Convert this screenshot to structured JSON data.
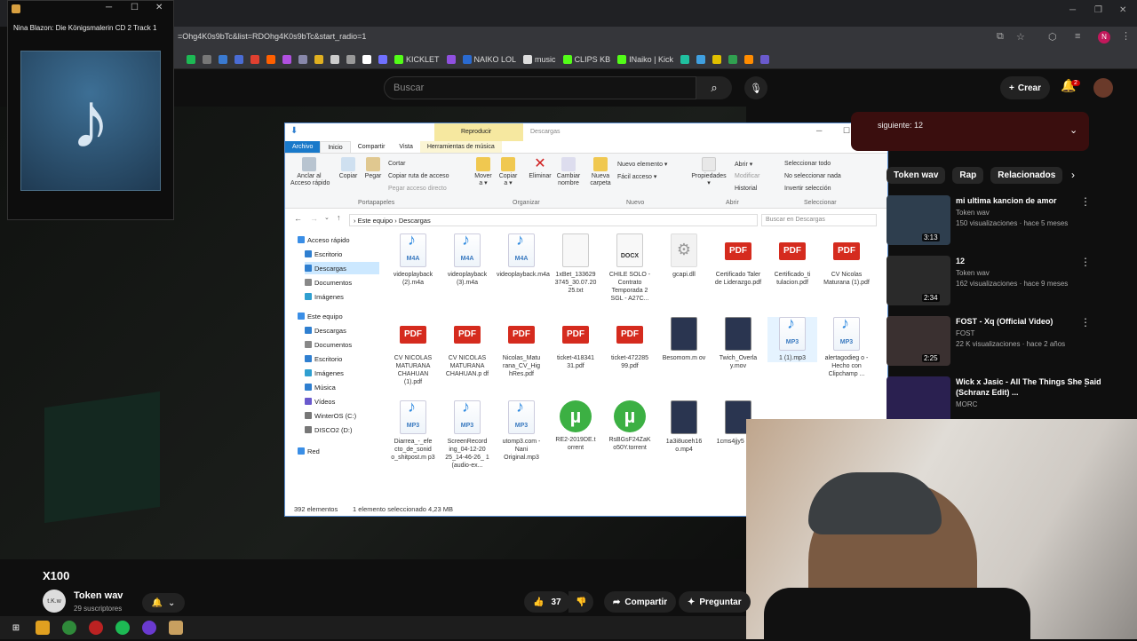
{
  "browser": {
    "url": "=Ohg4K0s9bTc&list=RDOhg4K0s9bTc&start_radio=1",
    "bookmarks": [
      {
        "label": "",
        "color": "#1db954"
      },
      {
        "label": "",
        "color": "#777"
      },
      {
        "label": "",
        "color": "#3a7ad0"
      },
      {
        "label": "",
        "color": "#4a6cd4"
      },
      {
        "label": "",
        "color": "#e04030"
      },
      {
        "label": "",
        "color": "#ff6000"
      },
      {
        "label": "",
        "color": "#b050e0"
      },
      {
        "label": "",
        "color": "#8888aa"
      },
      {
        "label": "",
        "color": "#e0b020"
      },
      {
        "label": "",
        "color": "#cccccc"
      },
      {
        "label": "",
        "color": "#999999"
      },
      {
        "label": "",
        "color": "#ffffff"
      },
      {
        "label": "",
        "color": "#7070ff"
      },
      {
        "label": "KICKLET",
        "color": "#53fc18"
      },
      {
        "label": "",
        "color": "#9050e0"
      },
      {
        "label": "NAIKO LOL",
        "color": "#2a6ad0"
      },
      {
        "label": "music",
        "color": "#dddddd"
      },
      {
        "label": "CLIPS KB",
        "color": "#53fc18"
      },
      {
        "label": "INaiko | Kick",
        "color": "#53fc18"
      },
      {
        "label": "",
        "color": "#20c0a0"
      },
      {
        "label": "",
        "color": "#40a0e0"
      },
      {
        "label": "",
        "color": "#e0c000"
      },
      {
        "label": "",
        "color": "#30a050"
      },
      {
        "label": "",
        "color": "#ff8c00"
      },
      {
        "label": "",
        "color": "#6a5acd"
      }
    ],
    "profile": "N"
  },
  "player": {
    "title": "Nina Blazon: Die Königsmalerin CD 2 Track 1",
    "art_icon": "music-note-icon"
  },
  "youtube": {
    "search_placeholder": "Buscar",
    "create_label": "Crear",
    "notifications": "2",
    "video_title": "X100",
    "channel_name": "Token wav",
    "channel_subs": "29 suscriptores",
    "channel_avatar_text": "t.K.w",
    "likes": "37",
    "share": "Compartir",
    "ask": "Preguntar",
    "queue_label": "siguiente: 12",
    "chips": [
      "Token wav",
      "Rap",
      "Relacionados"
    ],
    "related": [
      {
        "title": "mi ultima kancion de amor",
        "channel": "Token wav",
        "meta": "150 visualizaciones · hace 5 meses",
        "duration": "3:13",
        "thumb": "#2e3e4e"
      },
      {
        "title": "12",
        "channel": "Token wav",
        "meta": "162 visualizaciones · hace 9 meses",
        "duration": "2:34",
        "thumb": "#2a2a2a"
      },
      {
        "title": "FOST - Xq (Official Video)",
        "channel": "FOST",
        "meta": "22 K visualizaciones · hace 2 años",
        "duration": "2:25",
        "thumb": "#3a3030"
      },
      {
        "title": "Wick x Jasic - All The Things She Said (Schranz Edit) ...",
        "channel": "MORC",
        "meta": "",
        "duration": "",
        "thumb": "#2a2050"
      }
    ]
  },
  "explorer": {
    "context_tab": "Reproducir",
    "window_title": "Descargas",
    "tabs": [
      "Archivo",
      "Inicio",
      "Compartir",
      "Vista",
      "Herramientas de música"
    ],
    "ribbon": {
      "pin": "Anclar al\nAcceso rápido",
      "copy": "Copiar",
      "paste": "Pegar",
      "cut": "Cortar",
      "copy_path": "Copiar ruta de acceso",
      "paste_shortcut": "Pegar acceso directo",
      "move": "Mover\na ▾",
      "copyto": "Copiar\na ▾",
      "delete": "Eliminar",
      "rename": "Cambiar\nnombre",
      "newfolder": "Nueva\ncarpeta",
      "newitem": "Nuevo elemento ▾",
      "easy": "Fácil acceso ▾",
      "props": "Propiedades\n▾",
      "open": "Abrir ▾",
      "modify": "Modificar",
      "history": "Historial",
      "selall": "Seleccionar todo",
      "selnone": "No seleccionar nada",
      "invert": "Invertir selección",
      "groups": [
        "Portapapeles",
        "Organizar",
        "Nuevo",
        "Abrir",
        "Seleccionar"
      ]
    },
    "breadcrumb": "›  Este equipo  ›  Descargas",
    "search_placeholder": "Buscar en Descargas",
    "nav": [
      {
        "label": "Acceso rápido",
        "indent": 0,
        "color": "#3a8ee6"
      },
      {
        "label": "Escritorio",
        "indent": 1,
        "color": "#2f7fd0"
      },
      {
        "label": "Descargas",
        "indent": 1,
        "color": "#2f7fd0",
        "sel": true
      },
      {
        "label": "Documentos",
        "indent": 1,
        "color": "#888"
      },
      {
        "label": "Imágenes",
        "indent": 1,
        "color": "#2f9fd0"
      },
      {
        "label": "Este equipo",
        "indent": 0,
        "color": "#3a8ee6"
      },
      {
        "label": "Descargas",
        "indent": 1,
        "color": "#2f7fd0"
      },
      {
        "label": "Documentos",
        "indent": 1,
        "color": "#888"
      },
      {
        "label": "Escritorio",
        "indent": 1,
        "color": "#2f7fd0"
      },
      {
        "label": "Imágenes",
        "indent": 1,
        "color": "#2f9fd0"
      },
      {
        "label": "Música",
        "indent": 1,
        "color": "#2f7fd0"
      },
      {
        "label": "Vídeos",
        "indent": 1,
        "color": "#6a5acd"
      },
      {
        "label": "WinterOS (C:)",
        "indent": 1,
        "color": "#777"
      },
      {
        "label": "DISCO2 (D:)",
        "indent": 1,
        "color": "#777"
      },
      {
        "label": "Red",
        "indent": 0,
        "color": "#3a8ee6"
      }
    ],
    "files": [
      {
        "name": "videoplayback (2).m4a",
        "type": "m4a",
        "label": "M4A"
      },
      {
        "name": "videoplayback (3).m4a",
        "type": "m4a",
        "label": "M4A"
      },
      {
        "name": "videoplayback.m4a",
        "type": "m4a",
        "label": "M4A"
      },
      {
        "name": "1xBet_133629 3745_30.07.20 25.txt",
        "type": "txt",
        "label": ""
      },
      {
        "name": "CHILE SOLO - Contrato Temporada 2 SGL - A27C...",
        "type": "docx",
        "label": "DOCX"
      },
      {
        "name": "gcapi.dll",
        "type": "dll",
        "label": "⚙"
      },
      {
        "name": "Certificado Taler de Liderazgo.pdf",
        "type": "pdf",
        "label": "PDF"
      },
      {
        "name": "Certificado_ti tulacion.pdf",
        "type": "pdf",
        "label": "PDF"
      },
      {
        "name": "CV Nicolas Maturana (1).pdf",
        "type": "pdf",
        "label": "PDF"
      },
      {
        "name": "CV NICOLAS MATURANA CHAHUAN (1).pdf",
        "type": "pdf",
        "label": "PDF"
      },
      {
        "name": "CV NICOLAS MATURANA CHAHUAN.p df",
        "type": "pdf",
        "label": "PDF"
      },
      {
        "name": "Nicolas_Matu rana_CV_Hig hRes.pdf",
        "type": "pdf",
        "label": "PDF"
      },
      {
        "name": "ticket-418341 31.pdf",
        "type": "pdf",
        "label": "PDF"
      },
      {
        "name": "ticket-472285 99.pdf",
        "type": "pdf",
        "label": "PDF"
      },
      {
        "name": "Besomom.m ov",
        "type": "vid",
        "label": ""
      },
      {
        "name": "Twich_Overla y.mov",
        "type": "vid",
        "label": ""
      },
      {
        "name": "1 (1).mp3",
        "type": "mp3",
        "label": "MP3",
        "sel": true
      },
      {
        "name": "alertagodieg o - Hecho con Clipchamp ...",
        "type": "mp3",
        "label": "MP3"
      },
      {
        "name": "Diarrea_-_efe cto_de_sonid o_shitpost.m p3",
        "type": "mp3",
        "label": "MP3"
      },
      {
        "name": "ScreenRecord ing_04-12-20 25_14-46-26_ 1 (audio-ex...",
        "type": "mp3",
        "label": "MP3"
      },
      {
        "name": "utomp3.com - Nani Original.mp3",
        "type": "mp3",
        "label": "MP3"
      },
      {
        "name": "RE2-2019DE.t orrent",
        "type": "tor",
        "label": "µ"
      },
      {
        "name": "RsBGsF24ZaK o50Y.torrent",
        "type": "tor",
        "label": "µ"
      },
      {
        "name": "1a3i8uoeh16 o.mp4",
        "type": "vid",
        "label": ""
      },
      {
        "name": "1cms4jjy5 .mp4",
        "type": "vid",
        "label": ""
      }
    ],
    "status_count": "392 elementos",
    "status_sel": "1 elemento seleccionado  4,23 MB"
  }
}
